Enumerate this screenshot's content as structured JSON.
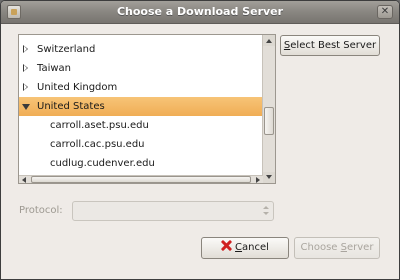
{
  "window": {
    "title": "Choose a Download Server",
    "icon": "app-icon",
    "close_icon": "close-icon"
  },
  "server_list": {
    "rows": [
      {
        "kind": "country",
        "label": "Switzerland",
        "expanded": false,
        "selected": false
      },
      {
        "kind": "country",
        "label": "Taiwan",
        "expanded": false,
        "selected": false
      },
      {
        "kind": "country",
        "label": "United Kingdom",
        "expanded": false,
        "selected": false
      },
      {
        "kind": "country",
        "label": "United States",
        "expanded": true,
        "selected": true
      },
      {
        "kind": "server",
        "label": "carroll.aset.psu.edu",
        "selected": false
      },
      {
        "kind": "server",
        "label": "carroll.cac.psu.edu",
        "selected": false
      },
      {
        "kind": "server",
        "label": "cudlug.cudenver.edu",
        "selected": false
      }
    ],
    "selection_color": "#f0ad55"
  },
  "buttons": {
    "select_best": {
      "mnemonic": "S",
      "rest": "elect Best Server"
    },
    "cancel": {
      "mnemonic": "C",
      "rest": "ancel",
      "icon": "cancel-x-icon",
      "icon_color": "#d02020"
    },
    "choose": {
      "pre": "Choose ",
      "mnemonic": "S",
      "rest": "erver",
      "enabled": false
    }
  },
  "protocol": {
    "label": "Protocol:",
    "value": "",
    "enabled": false
  }
}
